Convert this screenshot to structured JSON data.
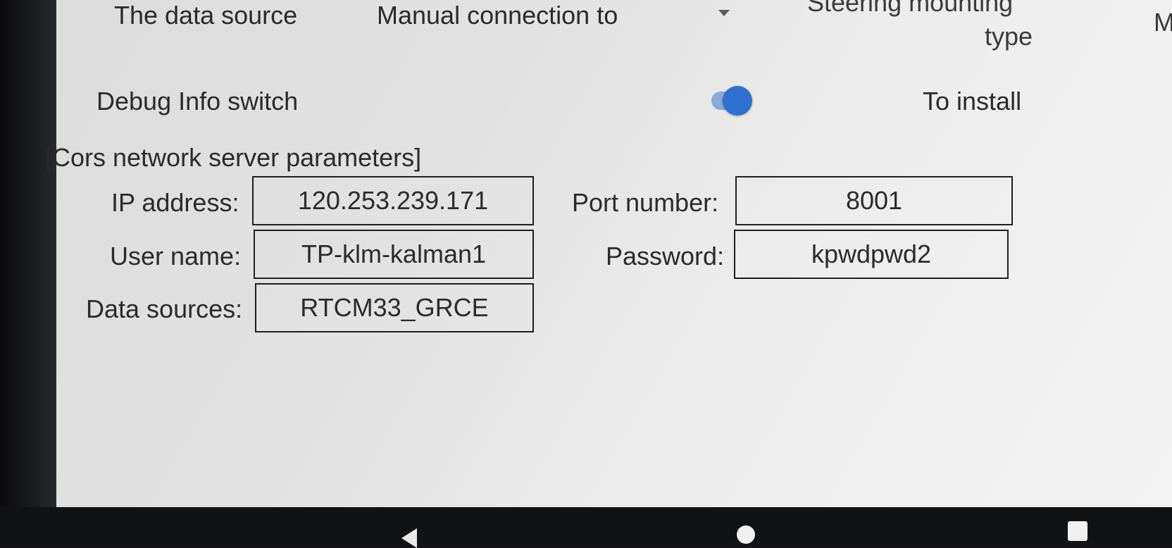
{
  "header": {
    "data_source_label": "The data source",
    "data_source_value": "Manual connection to",
    "steering_label_line1": "Steering mounting",
    "steering_label_line2": "type",
    "cut_label": "M"
  },
  "debug": {
    "label": "Debug Info switch",
    "toggle_on": true,
    "install_label": "To install"
  },
  "cors": {
    "section_title": "[Cors network server parameters]",
    "ip_label": "IP address:",
    "ip_value": "120.253.239.171",
    "port_label": "Port number:",
    "port_value": "8001",
    "user_label": "User name:",
    "user_value": "TP-klm-kalman1",
    "password_label": "Password:",
    "password_value": "kpwdpwd2",
    "sources_label": "Data sources:",
    "sources_value": "RTCM33_GRCE"
  },
  "navbar": {
    "icons": [
      "back-icon",
      "home-icon",
      "recent-apps-icon"
    ]
  },
  "colors": {
    "accent": "#2f6fcf",
    "screen_bg": "#e4e4e4",
    "bezel": "#141416"
  }
}
